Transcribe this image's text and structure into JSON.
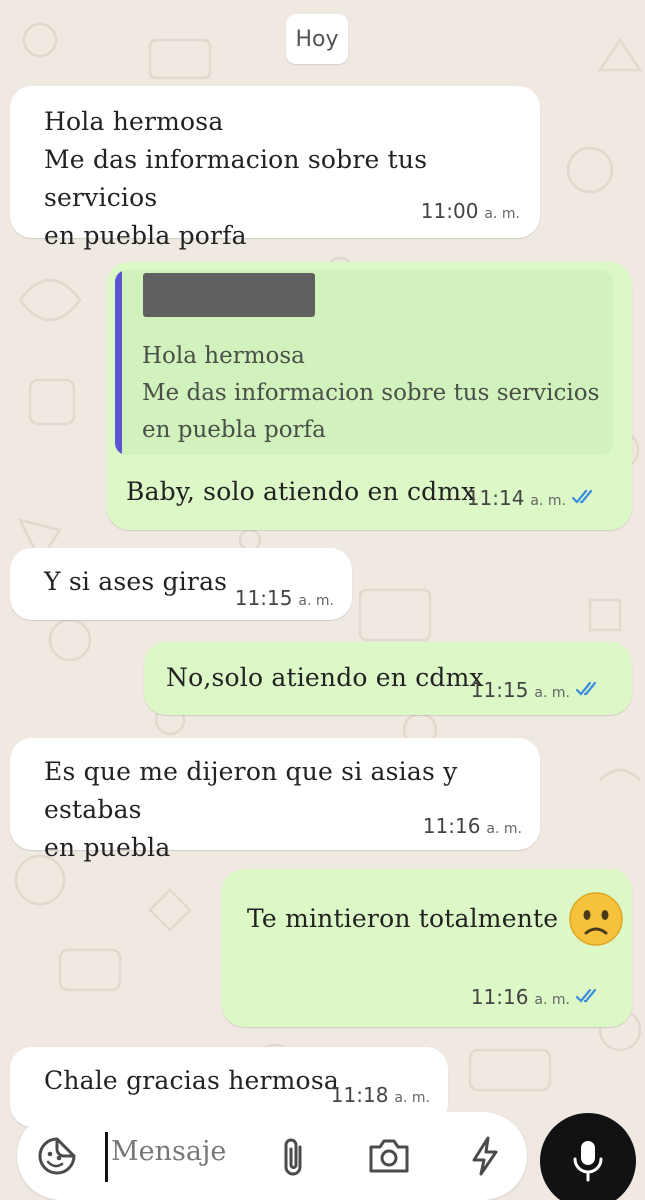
{
  "date_chip": "Hoy",
  "messages": [
    {
      "direction": "incoming",
      "text": "Hola hermosa\nMe das informacion sobre tus servicios\nen puebla porfa",
      "time": "11:00",
      "ampm": "a. m."
    },
    {
      "direction": "outgoing",
      "quoted_text": "Hola hermosa\nMe das informacion sobre tus servicios\nen puebla porfa",
      "text": "Baby, solo atiendo en cdmx",
      "time": "11:14",
      "ampm": "a. m.",
      "status": "read"
    },
    {
      "direction": "incoming",
      "text": "Y si ases giras",
      "time": "11:15",
      "ampm": "a. m."
    },
    {
      "direction": "outgoing",
      "text": "No,solo atiendo en cdmx",
      "time": "11:15",
      "ampm": "a. m.",
      "status": "read"
    },
    {
      "direction": "incoming",
      "text": "Es que me dijeron que si asias y estabas\nen puebla",
      "time": "11:16",
      "ampm": "a. m."
    },
    {
      "direction": "outgoing",
      "text": "Te mintieron totalmente",
      "emoji": "confused-face",
      "time": "11:16",
      "ampm": "a. m.",
      "status": "read"
    },
    {
      "direction": "incoming",
      "text": "Chale gracias hermosa",
      "time": "11:18",
      "ampm": "a. m."
    }
  ],
  "input": {
    "placeholder": "Mensaje"
  },
  "icons": [
    "sticker-icon",
    "attach-icon",
    "camera-icon",
    "bolt-icon",
    "mic-icon"
  ],
  "colors": {
    "incoming": "#ffffff",
    "outgoing": "#dcf8c6",
    "quote_bar": "#5b55d6",
    "read_ticks": "#3b8be0",
    "mic_button": "#121212"
  }
}
